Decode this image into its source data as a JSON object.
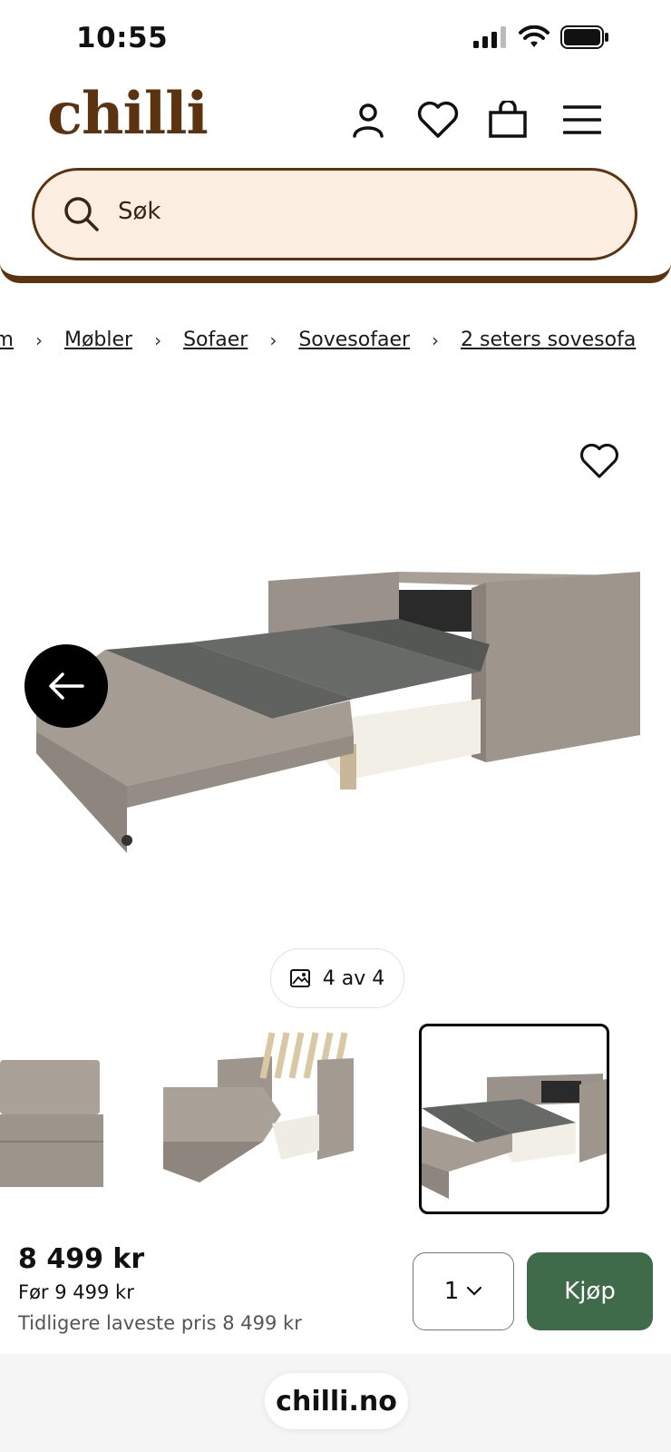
{
  "status_bar": {
    "time": "10:55"
  },
  "header": {
    "logo": "chilli"
  },
  "search": {
    "placeholder": "Søk"
  },
  "breadcrumb": [
    "em",
    "Møbler",
    "Sofaer",
    "Sovesofaer",
    "2 seters sovesofa"
  ],
  "gallery": {
    "counter": "4 av 4"
  },
  "buy_bar": {
    "price": "8 499 kr",
    "before_price": "Før 9 499 kr",
    "lowest_price": "Tidligere laveste pris 8 499 kr",
    "quantity": "1",
    "buy_label": "Kjøp"
  },
  "browser": {
    "url": "chilli.no"
  },
  "colors": {
    "brand": "#5b3310",
    "search_bg": "#fdeee2",
    "buy_button": "#3f6b4a"
  }
}
